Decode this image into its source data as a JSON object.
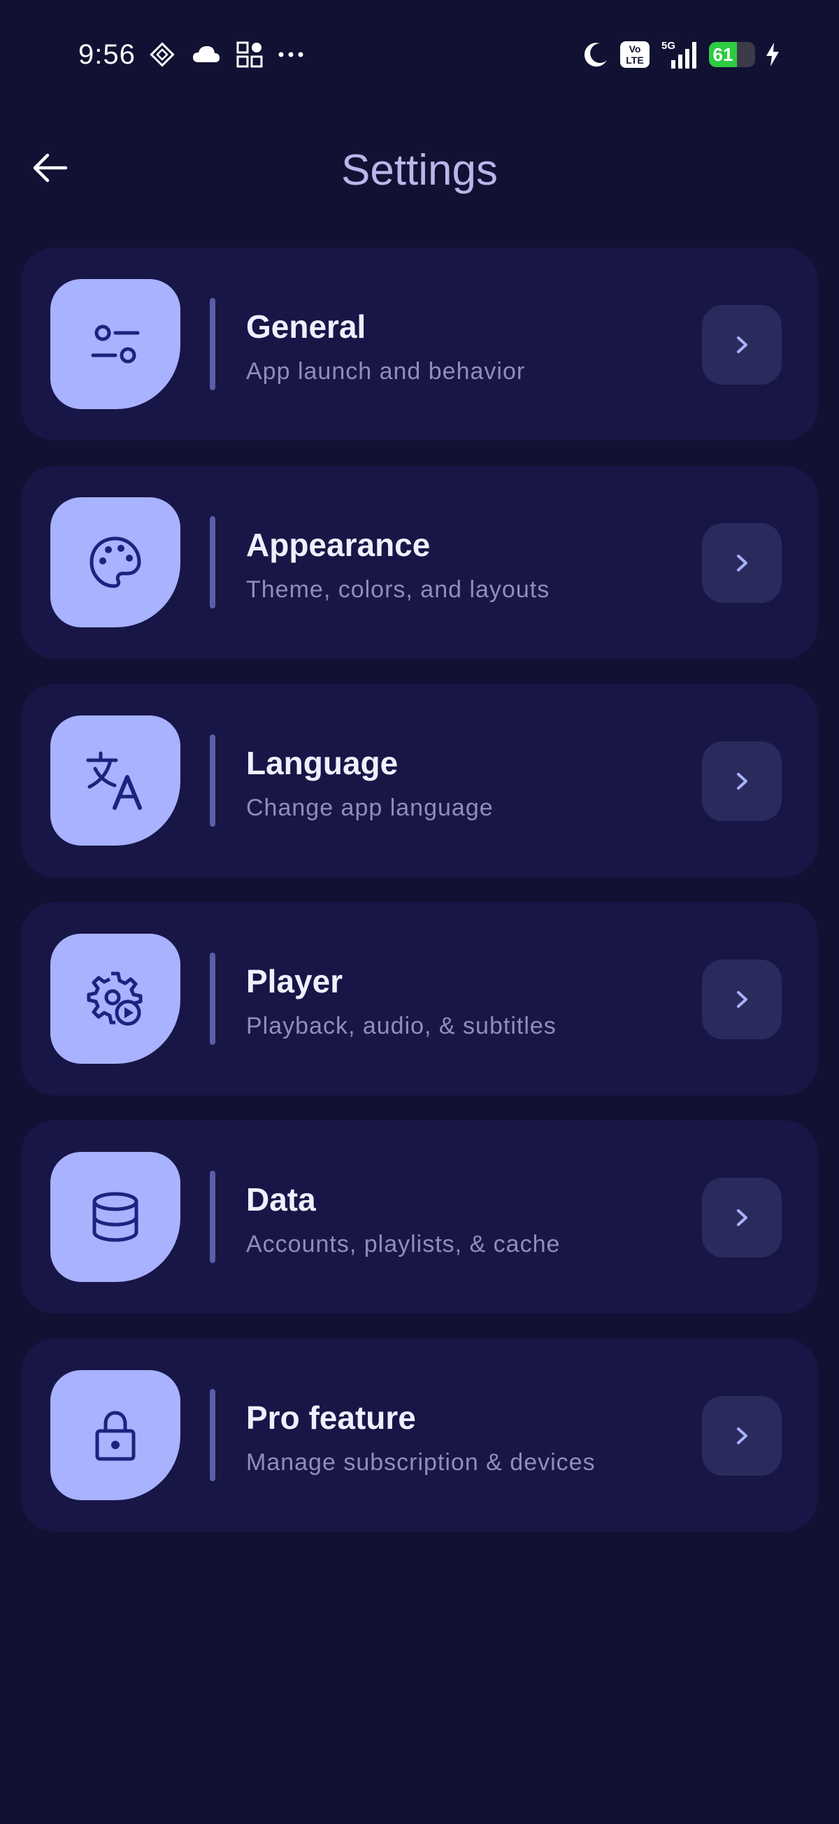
{
  "status_bar": {
    "time": "9:56",
    "battery_level": "61",
    "network": "5G",
    "volte": "Vo LTE"
  },
  "header": {
    "title": "Settings"
  },
  "colors": {
    "background": "#111133",
    "card": "#181646",
    "icon_tile": "#a8b2ff",
    "accent_icon": "#1a237e",
    "chevron_bg": "#2a2a5c",
    "chevron": "#a8b2ff",
    "battery": "#2ecc40"
  },
  "settings": [
    {
      "id": "general",
      "icon": "sliders-icon",
      "title": "General",
      "subtitle": "App launch and behavior"
    },
    {
      "id": "appearance",
      "icon": "palette-icon",
      "title": "Appearance",
      "subtitle": "Theme, colors, and layouts"
    },
    {
      "id": "language",
      "icon": "translate-icon",
      "title": "Language",
      "subtitle": "Change app language"
    },
    {
      "id": "player",
      "icon": "gear-play-icon",
      "title": "Player",
      "subtitle": "Playback, audio, & subtitles"
    },
    {
      "id": "data",
      "icon": "database-icon",
      "title": "Data",
      "subtitle": "Accounts, playlists, & cache"
    },
    {
      "id": "pro",
      "icon": "lock-icon",
      "title": "Pro feature",
      "subtitle": "Manage subscription & devices"
    }
  ]
}
